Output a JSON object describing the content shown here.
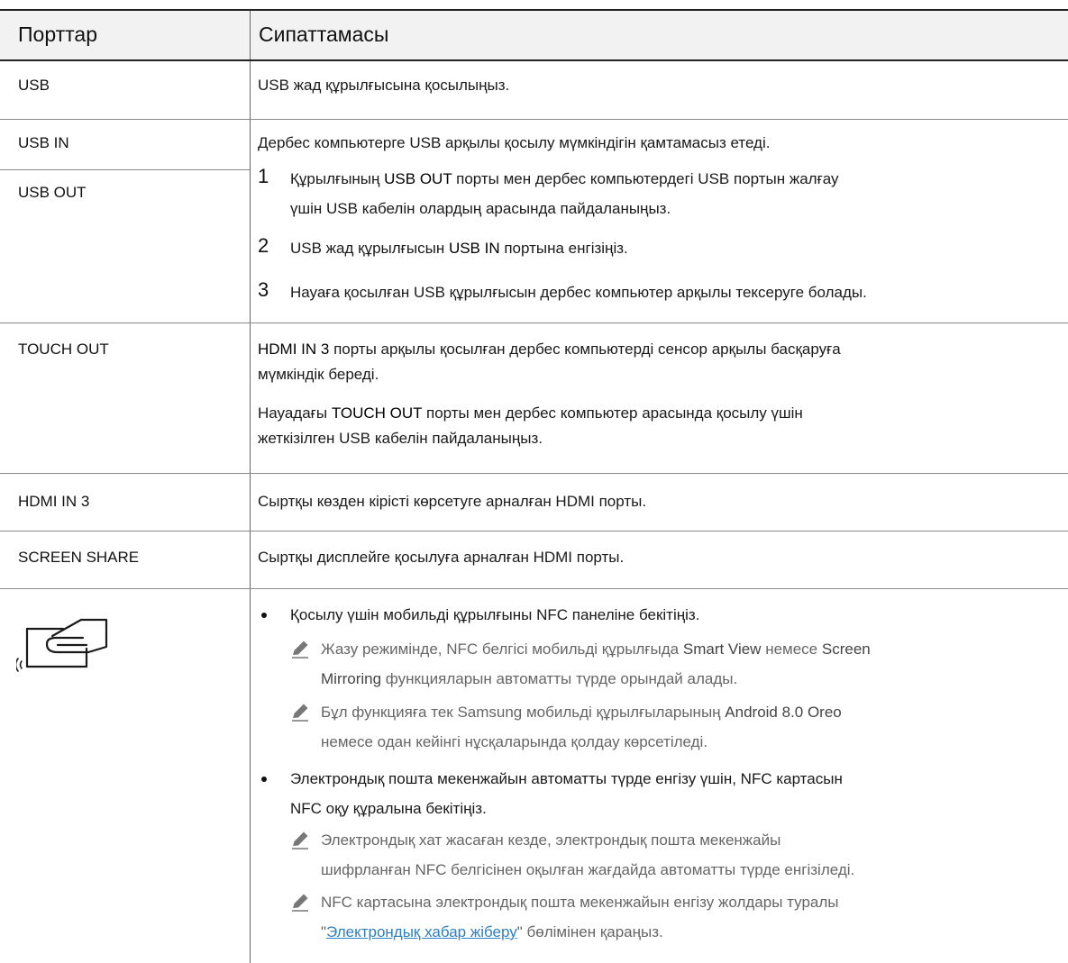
{
  "header": {
    "col_ports": "Порттар",
    "col_desc": "Сипаттамасы"
  },
  "rows": {
    "usb": {
      "port": "USB",
      "desc": "USB жад құрылғысына қосылыңыз."
    },
    "usb_in_out": {
      "port_in": "USB IN",
      "port_out": "USB OUT",
      "intro": "Дербес компьютерге USB арқылы қосылу мүмкіндігін қамтамасыз етеді.",
      "steps": [
        {
          "num": "1",
          "line1_a": "Құрылғының ",
          "line1_kw": "USB OUT",
          "line1_b": " порты мен дербес компьютердегі USB портын жалғау",
          "line2": "үшін USB кабелін олардың арасында пайдаланыңыз."
        },
        {
          "num": "2",
          "a": "USB жад құрылғысын ",
          "kw": "USB IN",
          "b": " портына енгізіңіз."
        },
        {
          "num": "3",
          "text": "Науаға қосылған USB құрылғысын дербес компьютер арқылы тексеруге болады."
        }
      ]
    },
    "touch_out": {
      "port": "TOUCH OUT",
      "p1_kw": "HDMI IN 3",
      "p1_a": " порты арқылы қосылған дербес компьютерді сенсор арқылы басқаруға",
      "p1_b": "мүмкіндік береді.",
      "p2_a": "Науадағы ",
      "p2_kw": "TOUCH OUT",
      "p2_b": " порты мен дербес компьютер арасында қосылу үшін",
      "p2_c": "жеткізілген USB кабелін пайдаланыңыз."
    },
    "hdmi_in3": {
      "port": "HDMI IN 3",
      "desc": "Сыртқы көзден кірісті көрсетуге арналған HDMI порты."
    },
    "screen_share": {
      "port": "SCREEN SHARE",
      "desc": "Сыртқы дисплейге қосылуға арналған HDMI порты."
    },
    "nfc": {
      "icon": "nfc-tap-icon",
      "bullet1": "Қосылу үшін мобильді құрылғыны NFC панеліне бекітіңіз.",
      "note1_a": "Жазу режимінде, NFC белгісі мобильді құрылғыда ",
      "note1_kw1": "Smart View",
      "note1_b": " немесе ",
      "note1_kw2": "Screen",
      "note1_kw3": "Mirroring",
      "note1_c": " функцияларын автоматты түрде орындай алады.",
      "note2_a": "Бұл функцияға тек Samsung мобильді құрылғыларының ",
      "note2_kw": "Android 8.0 Oreo",
      "note2_b": "немесе одан кейінгі нұсқаларында қолдау көрсетіледі.",
      "bullet2_a": "Электрондық пошта мекенжайын автоматты түрде енгізу үшін, NFC картасын",
      "bullet2_b": "NFC оқу құралына бекітіңіз.",
      "note3_a": "Электрондық хат жасаған кезде, электрондық пошта мекенжайы",
      "note3_b": "шифрланған NFC белгісінен оқылған жағдайда автоматты түрде енгізіледі.",
      "note4_a": "NFC картасына электрондық пошта мекенжайын енгізу жолдары туралы",
      "note4_q1": "\"",
      "note4_link": "Электрондық хабар жіберу",
      "note4_q2": "\"",
      "note4_c": " бөлімінен қараңыз."
    }
  },
  "colors": {
    "link": "#2e7fbf",
    "note_text": "#666666",
    "header_bg": "#f2f2f2"
  }
}
